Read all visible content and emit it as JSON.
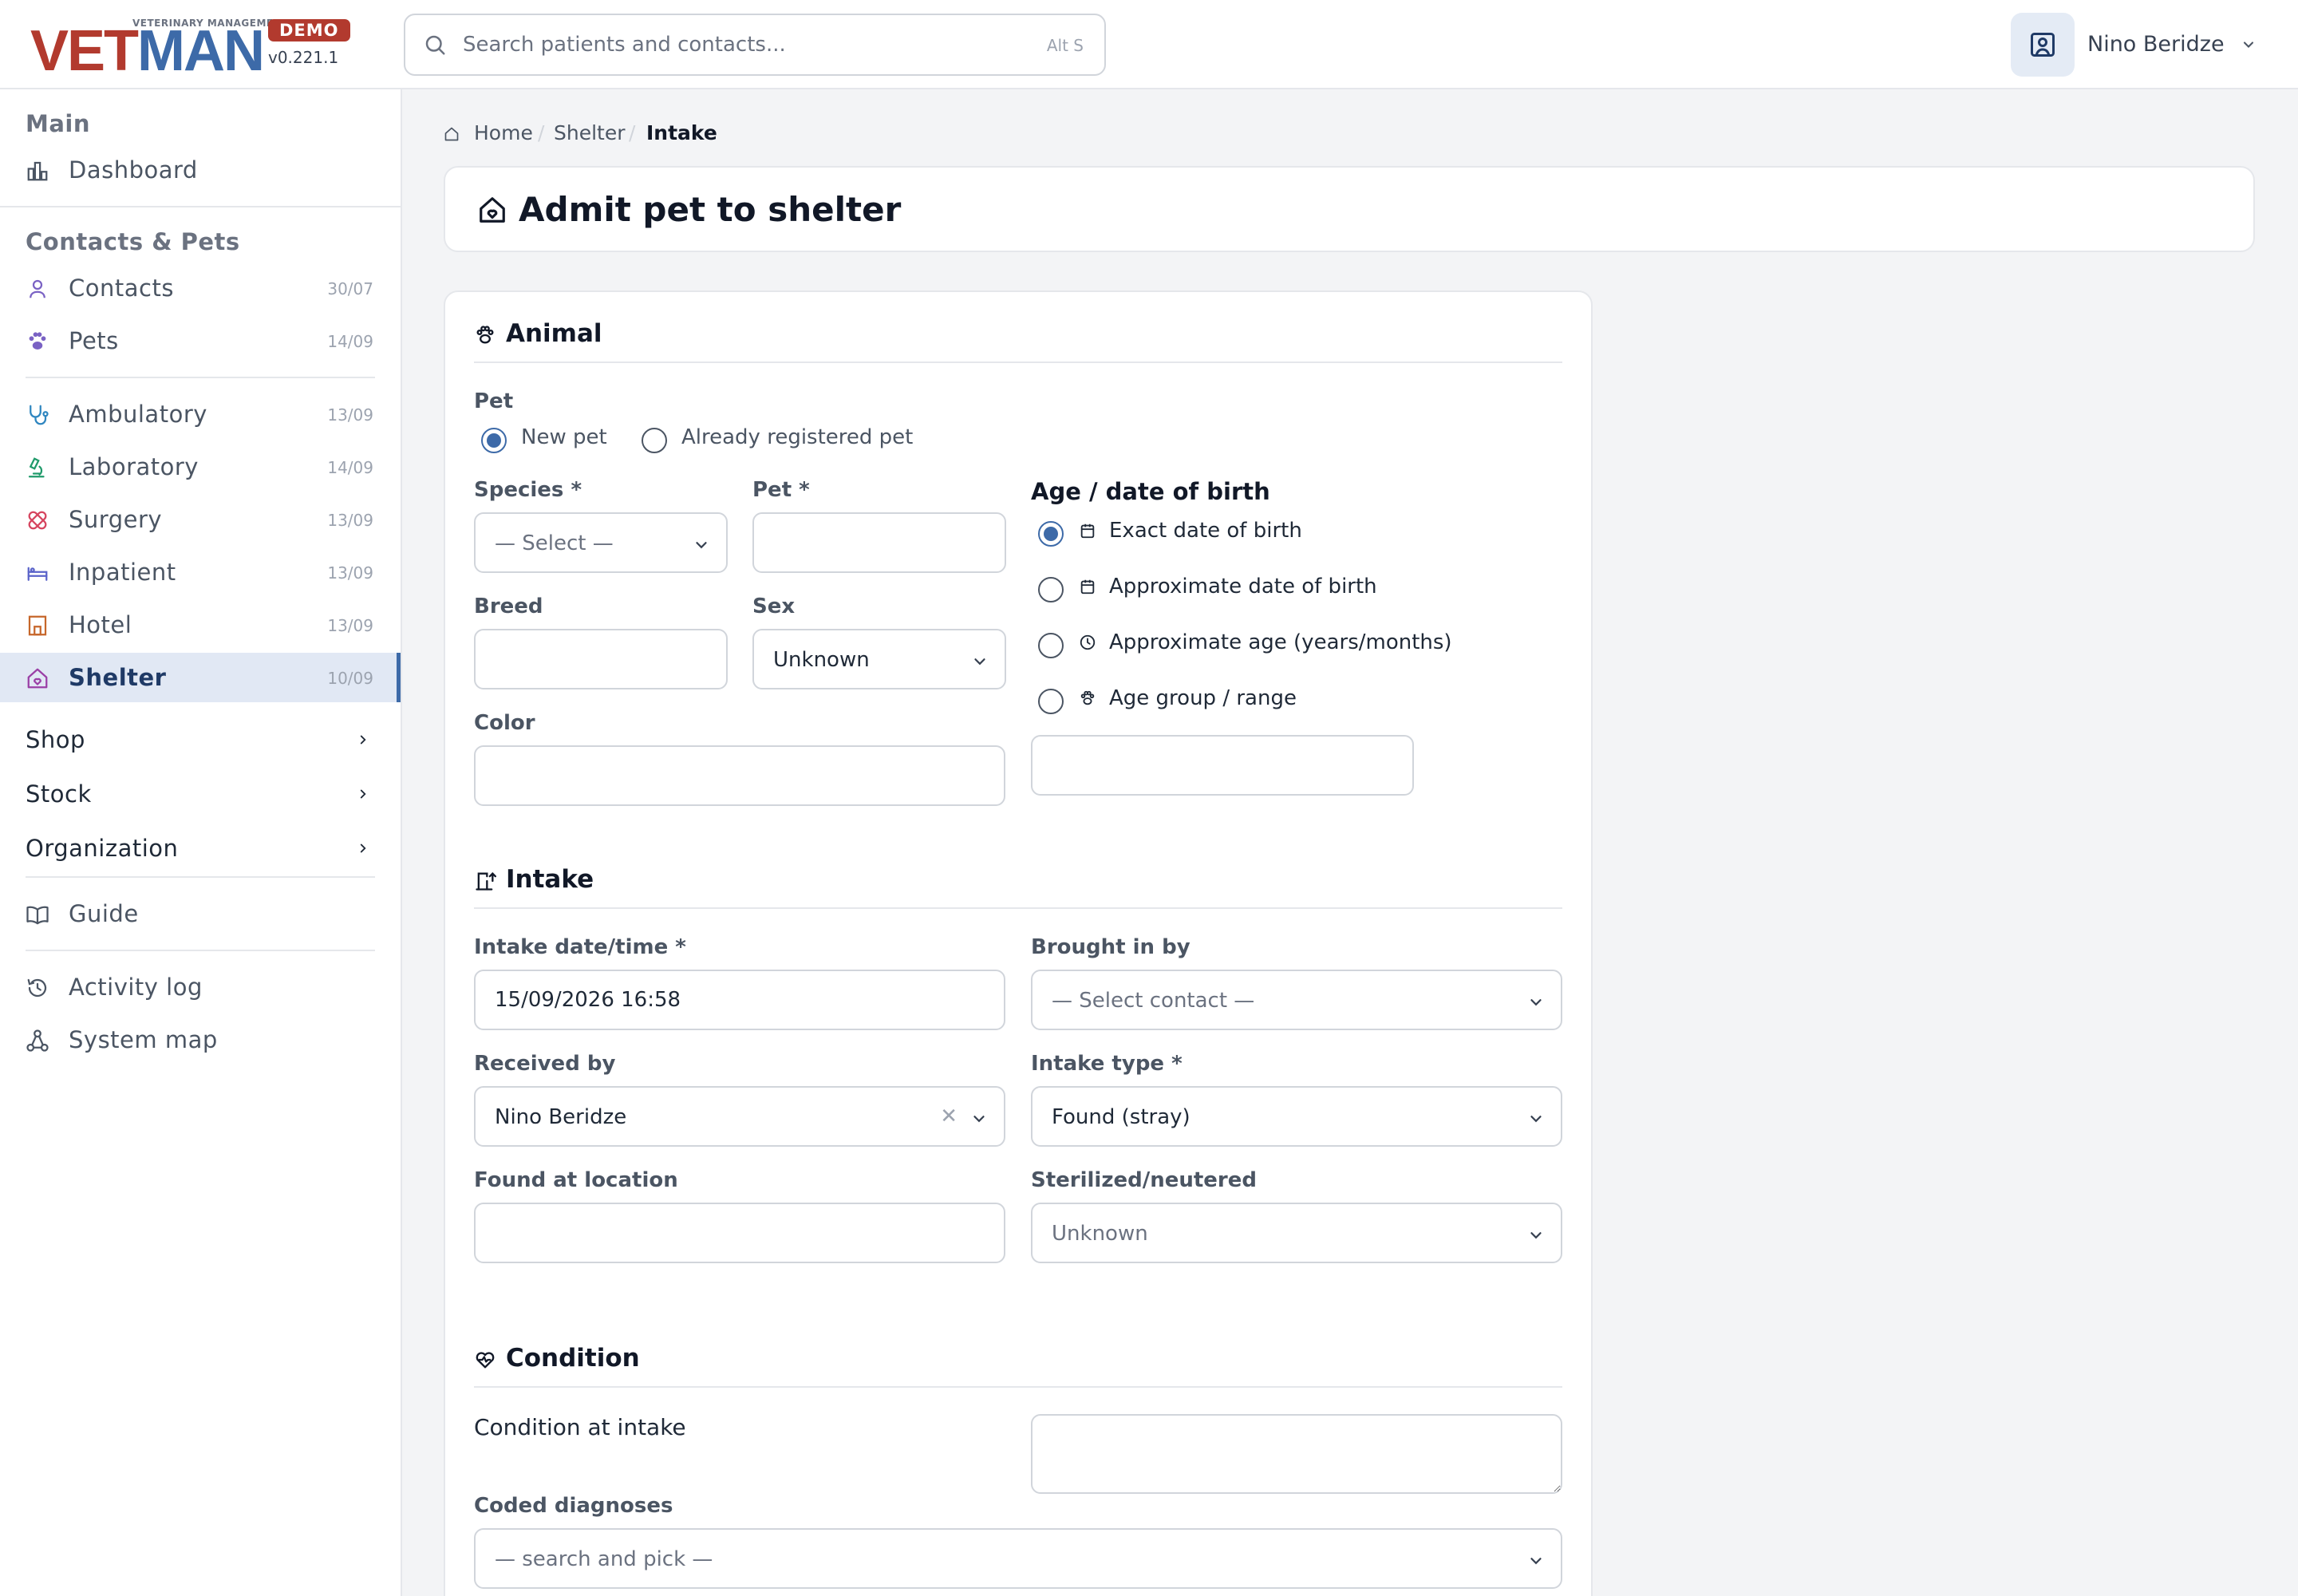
{
  "app": {
    "logo_tagline": "VETERINARY MANAGEMENT",
    "logo_vet": "VET",
    "logo_man": "MAN",
    "badge": "DEMO",
    "version": "v0.221.1"
  },
  "search": {
    "placeholder": "Search patients and contacts...",
    "shortcut": "Alt S"
  },
  "user": {
    "name": "Nino Beridze"
  },
  "sidebar": {
    "groups": [
      {
        "title": "Main"
      },
      {
        "title": "Contacts & Pets"
      }
    ],
    "items": [
      {
        "label": "Dashboard",
        "icon": "bar-chart-icon",
        "count": ""
      },
      {
        "label": "Contacts",
        "icon": "person-icon",
        "count": "30/07"
      },
      {
        "label": "Pets",
        "icon": "paw-icon",
        "count": "14/09"
      },
      {
        "label": "Ambulatory",
        "icon": "stethoscope-icon",
        "count": "13/09"
      },
      {
        "label": "Laboratory",
        "icon": "microscope-icon",
        "count": "14/09"
      },
      {
        "label": "Surgery",
        "icon": "bandage-icon",
        "count": "13/09"
      },
      {
        "label": "Inpatient",
        "icon": "bed-icon",
        "count": "13/09"
      },
      {
        "label": "Hotel",
        "icon": "building-icon",
        "count": "13/09"
      },
      {
        "label": "Shelter",
        "icon": "house-heart-icon",
        "count": "10/09"
      }
    ],
    "expandables": [
      {
        "label": "Shop"
      },
      {
        "label": "Stock"
      },
      {
        "label": "Organization"
      }
    ],
    "extra": [
      {
        "label": "Guide",
        "icon": "book-icon"
      },
      {
        "label": "Activity log",
        "icon": "history-icon"
      },
      {
        "label": "System map",
        "icon": "diagram-icon"
      }
    ]
  },
  "breadcrumb": {
    "home": "Home",
    "section": "Shelter",
    "current": "Intake",
    "sep": "/"
  },
  "page": {
    "title": "Admit pet to shelter"
  },
  "animal": {
    "title": "Animal",
    "pet_label": "Pet",
    "pet_options": [
      "New pet",
      "Already registered pet"
    ],
    "pet_selected": "New pet",
    "species_label": "Species *",
    "species_value": "— Select —",
    "petname_label": "Pet *",
    "petname_value": "",
    "breed_label": "Breed",
    "breed_value": "",
    "sex_label": "Sex",
    "sex_value": "Unknown",
    "color_label": "Color",
    "color_value": "",
    "age_label": "Age / date of birth",
    "age_options": [
      {
        "label": "Exact date of birth",
        "icon": "calendar-icon"
      },
      {
        "label": "Approximate date of birth",
        "icon": "calendar-icon"
      },
      {
        "label": "Approximate age (years/months)",
        "icon": "clock-icon"
      },
      {
        "label": "Age group / range",
        "icon": "paw-icon"
      }
    ],
    "age_selected": "Exact date of birth",
    "age_value": ""
  },
  "intake": {
    "title": "Intake",
    "datetime_label": "Intake date/time *",
    "datetime_value": "15/09/2026 16:58",
    "brought_label": "Brought in by",
    "brought_value": "— Select contact —",
    "received_label": "Received by",
    "received_value": "Nino Beridze",
    "type_label": "Intake type *",
    "type_value": "Found (stray)",
    "location_label": "Found at location",
    "location_value": "",
    "sterilized_label": "Sterilized/neutered",
    "sterilized_value": "Unknown"
  },
  "condition": {
    "title": "Condition",
    "condition_label": "Condition at intake",
    "condition_value": "",
    "diagnoses_label": "Coded diagnoses",
    "diagnoses_value": "— search and pick —"
  },
  "colors": {
    "brand_red": "#b23a2e",
    "brand_blue": "#3d6aa8",
    "active_bg": "#e1e8f4"
  }
}
